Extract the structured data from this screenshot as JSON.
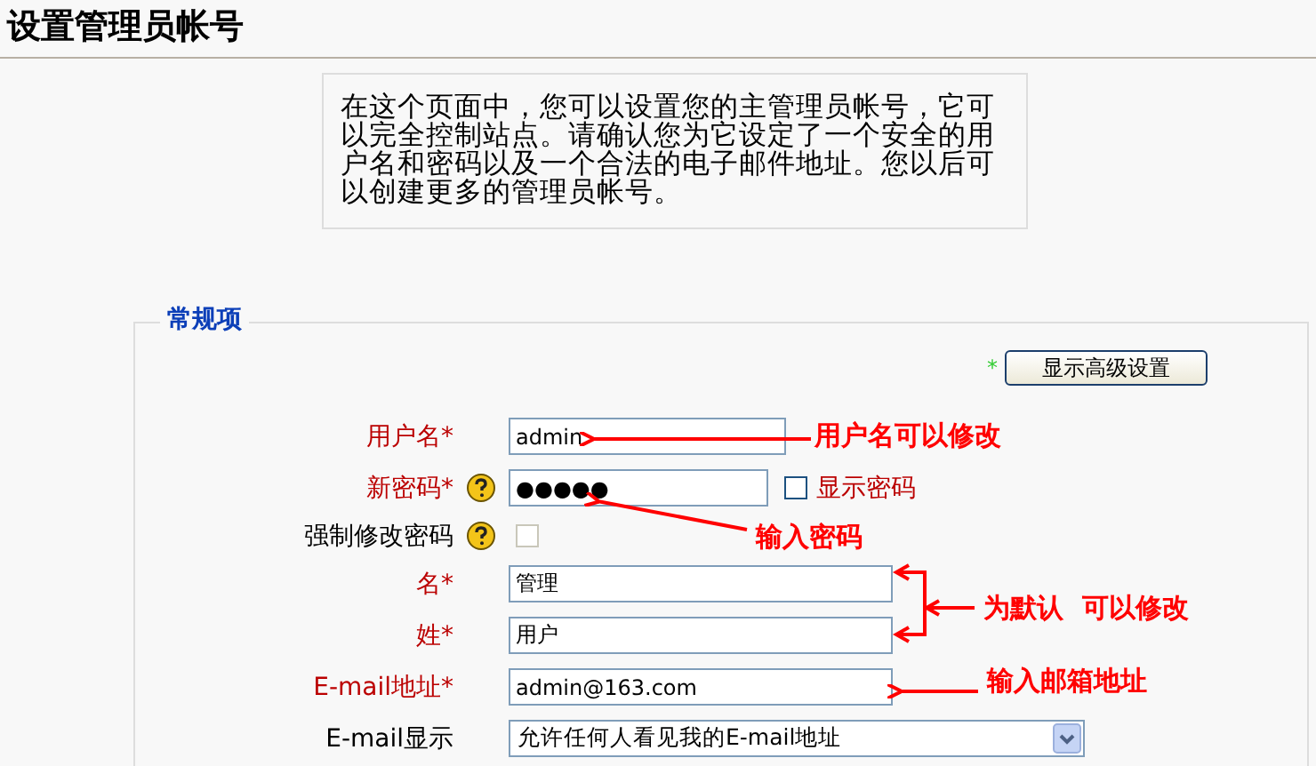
{
  "page_title": "设置管理员帐号",
  "intro": "在这个页面中，您可以设置您的主管理员帐号，它可以完全控制站点。请确认您为它设定了一个安全的用户名和密码以及一个合法的电子邮件地址。您以后可以创建更多的管理员帐号。",
  "section": {
    "legend": "常规项",
    "advanced_button": "显示高级设置",
    "advanced_required_mark": "*",
    "fields": [
      {
        "kind": "text",
        "label": "用户名",
        "required": true,
        "help": false,
        "value": "admin"
      },
      {
        "kind": "password",
        "label": "新密码",
        "required": true,
        "help": true,
        "value": "●●●●●",
        "show_label": "显示密码",
        "checked": false
      },
      {
        "kind": "checkbox",
        "label": "强制修改密码",
        "required": false,
        "help": true,
        "checked": false,
        "disabled": true
      },
      {
        "kind": "text",
        "label": "名",
        "required": true,
        "help": false,
        "value": "管理"
      },
      {
        "kind": "text",
        "label": "姓",
        "required": true,
        "help": false,
        "value": "用户"
      },
      {
        "kind": "text",
        "label": "E-mail地址",
        "required": true,
        "help": false,
        "value": "admin@163.com"
      },
      {
        "kind": "select",
        "label": "E-mail显示",
        "required": false,
        "help": false,
        "value": "允许任何人看见我的E-mail地址"
      }
    ]
  },
  "annotations": [
    "用户名可以修改",
    "输入密码",
    "为默认  可以修改",
    "输入邮箱地址"
  ]
}
